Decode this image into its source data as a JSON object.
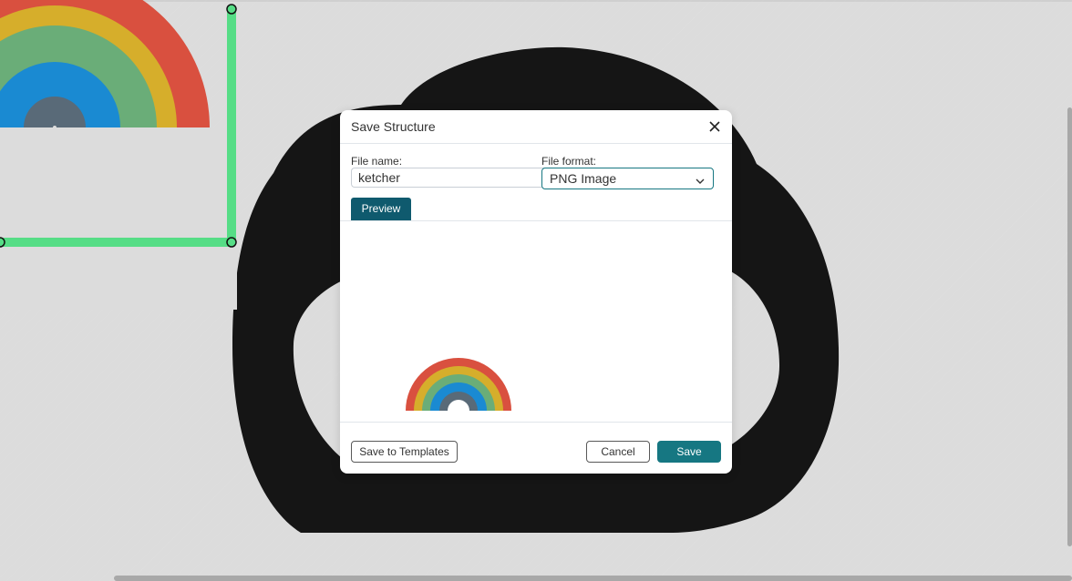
{
  "dialog": {
    "title": "Save Structure",
    "file_name_label": "File name:",
    "file_name_value": "ketcher",
    "file_format_label": "File format:",
    "file_format_value": "PNG Image",
    "preview_tab": "Preview",
    "save_to_templates": "Save to Templates",
    "cancel": "Cancel",
    "save": "Save"
  },
  "icons": {
    "close": "close-icon",
    "chevron": "chevron-down-icon",
    "benzene": "benzene-ring-icon"
  },
  "colors": {
    "accent": "#167782",
    "tab_active": "#0f5a6e",
    "selection": "#56dd86",
    "rainbow_red": "#d9503f",
    "rainbow_yellow": "#d6ae2b",
    "rainbow_green": "#6aad78",
    "rainbow_blue": "#1a8ad2",
    "rainbow_slate": "#596a78",
    "cloud": "#151515"
  }
}
